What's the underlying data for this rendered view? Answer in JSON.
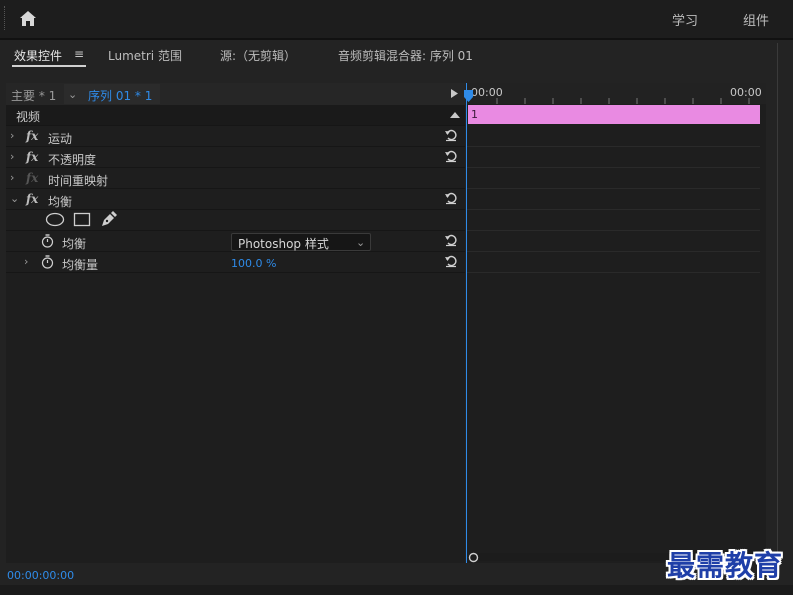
{
  "header": {
    "workspaces": [
      "学习",
      "组件"
    ],
    "home_icon": "home-icon"
  },
  "tabs": [
    {
      "label": "效果控件"
    },
    {
      "label": "Lumetri 范围"
    },
    {
      "label": "源:（无剪辑）"
    },
    {
      "label": "音频剪辑混合器: 序列 01"
    }
  ],
  "tab_menu_glyph": "≡",
  "source": {
    "master": "主要 * 1",
    "sequence": "序列 01 * 1"
  },
  "section_video": "视频",
  "fx_label": "fx",
  "effects": [
    {
      "name": "运动"
    },
    {
      "name": "不透明度"
    },
    {
      "name": "时间重映射"
    },
    {
      "name": "均衡"
    }
  ],
  "properties": [
    {
      "name": "均衡",
      "value": "Photoshop 样式"
    },
    {
      "name": "均衡量",
      "value": "100.0 %"
    }
  ],
  "timeline": {
    "start": "00:00",
    "end": "00:00",
    "clip_label": "1"
  },
  "status_time": "00:00:00:00",
  "watermark": "最需教育",
  "colors": {
    "accent": "#2f8be8",
    "clip": "#e98ae2",
    "background": "#232323"
  }
}
